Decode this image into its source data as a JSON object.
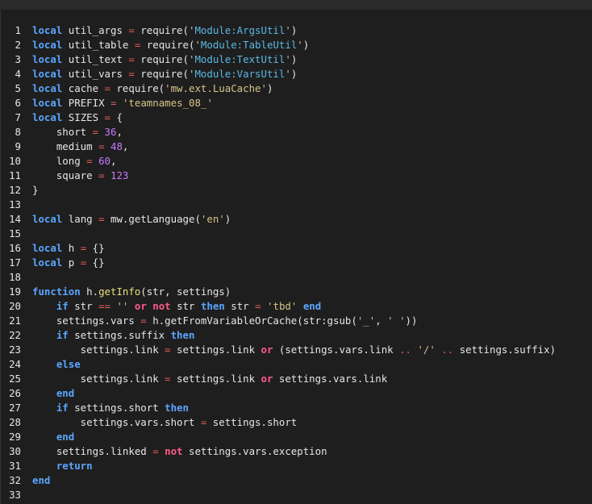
{
  "editor": {
    "lines": [
      {
        "n": "1",
        "tokens": [
          [
            "kw",
            "local"
          ],
          [
            "plain",
            " util_args "
          ],
          [
            "op",
            "="
          ],
          [
            "plain",
            " require("
          ],
          [
            "str",
            "'"
          ],
          [
            "mod",
            "Module:ArgsUtil"
          ],
          [
            "str",
            "'"
          ],
          [
            "plain",
            ")"
          ]
        ]
      },
      {
        "n": "2",
        "tokens": [
          [
            "kw",
            "local"
          ],
          [
            "plain",
            " util_table "
          ],
          [
            "op",
            "="
          ],
          [
            "plain",
            " require("
          ],
          [
            "str",
            "'"
          ],
          [
            "mod",
            "Module:TableUtil"
          ],
          [
            "str",
            "'"
          ],
          [
            "plain",
            ")"
          ]
        ]
      },
      {
        "n": "3",
        "tokens": [
          [
            "kw",
            "local"
          ],
          [
            "plain",
            " util_text "
          ],
          [
            "op",
            "="
          ],
          [
            "plain",
            " require("
          ],
          [
            "str",
            "'"
          ],
          [
            "mod",
            "Module:TextUtil"
          ],
          [
            "str",
            "'"
          ],
          [
            "plain",
            ")"
          ]
        ]
      },
      {
        "n": "4",
        "tokens": [
          [
            "kw",
            "local"
          ],
          [
            "plain",
            " util_vars "
          ],
          [
            "op",
            "="
          ],
          [
            "plain",
            " require("
          ],
          [
            "str",
            "'"
          ],
          [
            "mod",
            "Module:VarsUtil"
          ],
          [
            "str",
            "'"
          ],
          [
            "plain",
            ")"
          ]
        ]
      },
      {
        "n": "5",
        "tokens": [
          [
            "kw",
            "local"
          ],
          [
            "plain",
            " cache "
          ],
          [
            "op",
            "="
          ],
          [
            "plain",
            " require("
          ],
          [
            "str",
            "'mw.ext.LuaCache'"
          ],
          [
            "plain",
            ")"
          ]
        ]
      },
      {
        "n": "6",
        "tokens": [
          [
            "kw",
            "local"
          ],
          [
            "plain",
            " PREFIX "
          ],
          [
            "op",
            "="
          ],
          [
            "plain",
            " "
          ],
          [
            "str",
            "'teamnames_08_'"
          ]
        ]
      },
      {
        "n": "7",
        "tokens": [
          [
            "kw",
            "local"
          ],
          [
            "plain",
            " SIZES "
          ],
          [
            "op",
            "="
          ],
          [
            "plain",
            " {"
          ]
        ]
      },
      {
        "n": "8",
        "tokens": [
          [
            "plain",
            "    short "
          ],
          [
            "op",
            "="
          ],
          [
            "plain",
            " "
          ],
          [
            "num",
            "36"
          ],
          [
            "plain",
            ","
          ]
        ]
      },
      {
        "n": "9",
        "tokens": [
          [
            "plain",
            "    medium "
          ],
          [
            "op",
            "="
          ],
          [
            "plain",
            " "
          ],
          [
            "num",
            "48"
          ],
          [
            "plain",
            ","
          ]
        ]
      },
      {
        "n": "10",
        "tokens": [
          [
            "plain",
            "    long "
          ],
          [
            "op",
            "="
          ],
          [
            "plain",
            " "
          ],
          [
            "num",
            "60"
          ],
          [
            "plain",
            ","
          ]
        ]
      },
      {
        "n": "11",
        "tokens": [
          [
            "plain",
            "    square "
          ],
          [
            "op",
            "="
          ],
          [
            "plain",
            " "
          ],
          [
            "num",
            "123"
          ]
        ]
      },
      {
        "n": "12",
        "tokens": [
          [
            "plain",
            "}"
          ]
        ]
      },
      {
        "n": "13",
        "tokens": []
      },
      {
        "n": "14",
        "tokens": [
          [
            "kw",
            "local"
          ],
          [
            "plain",
            " lang "
          ],
          [
            "op",
            "="
          ],
          [
            "plain",
            " mw.getLanguage("
          ],
          [
            "str",
            "'en'"
          ],
          [
            "plain",
            ")"
          ]
        ]
      },
      {
        "n": "15",
        "tokens": []
      },
      {
        "n": "16",
        "tokens": [
          [
            "kw",
            "local"
          ],
          [
            "plain",
            " h "
          ],
          [
            "op",
            "="
          ],
          [
            "plain",
            " {}"
          ]
        ]
      },
      {
        "n": "17",
        "tokens": [
          [
            "kw",
            "local"
          ],
          [
            "plain",
            " p "
          ],
          [
            "op",
            "="
          ],
          [
            "plain",
            " {}"
          ]
        ]
      },
      {
        "n": "18",
        "tokens": []
      },
      {
        "n": "19",
        "tokens": [
          [
            "kw",
            "function"
          ],
          [
            "plain",
            " h."
          ],
          [
            "fn",
            "getInfo"
          ],
          [
            "plain",
            "(str, settings)"
          ]
        ]
      },
      {
        "n": "20",
        "tokens": [
          [
            "plain",
            "    "
          ],
          [
            "kw",
            "if"
          ],
          [
            "plain",
            " str "
          ],
          [
            "op",
            "=="
          ],
          [
            "plain",
            " "
          ],
          [
            "str",
            "''"
          ],
          [
            "plain",
            " "
          ],
          [
            "kw2",
            "or"
          ],
          [
            "plain",
            " "
          ],
          [
            "kw2",
            "not"
          ],
          [
            "plain",
            " str "
          ],
          [
            "kw",
            "then"
          ],
          [
            "plain",
            " str "
          ],
          [
            "op",
            "="
          ],
          [
            "plain",
            " "
          ],
          [
            "str",
            "'tbd'"
          ],
          [
            "plain",
            " "
          ],
          [
            "kw",
            "end"
          ]
        ]
      },
      {
        "n": "21",
        "tokens": [
          [
            "plain",
            "    settings.vars "
          ],
          [
            "op",
            "="
          ],
          [
            "plain",
            " h.getFromVariableOrCache(str:gsub("
          ],
          [
            "str",
            "'_'"
          ],
          [
            "plain",
            ", "
          ],
          [
            "str",
            "' '"
          ],
          [
            "plain",
            "))"
          ]
        ]
      },
      {
        "n": "22",
        "tokens": [
          [
            "plain",
            "    "
          ],
          [
            "kw",
            "if"
          ],
          [
            "plain",
            " settings.suffix "
          ],
          [
            "kw",
            "then"
          ]
        ]
      },
      {
        "n": "23",
        "tokens": [
          [
            "plain",
            "        settings.link "
          ],
          [
            "op",
            "="
          ],
          [
            "plain",
            " settings.link "
          ],
          [
            "kw2",
            "or"
          ],
          [
            "plain",
            " (settings.vars.link "
          ],
          [
            "op",
            ".."
          ],
          [
            "plain",
            " "
          ],
          [
            "str",
            "'/'"
          ],
          [
            "plain",
            " "
          ],
          [
            "op",
            ".."
          ],
          [
            "plain",
            " settings.suffix)"
          ]
        ]
      },
      {
        "n": "24",
        "tokens": [
          [
            "plain",
            "    "
          ],
          [
            "kw",
            "else"
          ]
        ]
      },
      {
        "n": "25",
        "tokens": [
          [
            "plain",
            "        settings.link "
          ],
          [
            "op",
            "="
          ],
          [
            "plain",
            " settings.link "
          ],
          [
            "kw2",
            "or"
          ],
          [
            "plain",
            " settings.vars.link"
          ]
        ]
      },
      {
        "n": "26",
        "tokens": [
          [
            "plain",
            "    "
          ],
          [
            "kw",
            "end"
          ]
        ]
      },
      {
        "n": "27",
        "tokens": [
          [
            "plain",
            "    "
          ],
          [
            "kw",
            "if"
          ],
          [
            "plain",
            " settings.short "
          ],
          [
            "kw",
            "then"
          ]
        ]
      },
      {
        "n": "28",
        "tokens": [
          [
            "plain",
            "        settings.vars.short "
          ],
          [
            "op",
            "="
          ],
          [
            "plain",
            " settings.short"
          ]
        ]
      },
      {
        "n": "29",
        "tokens": [
          [
            "plain",
            "    "
          ],
          [
            "kw",
            "end"
          ]
        ]
      },
      {
        "n": "30",
        "tokens": [
          [
            "plain",
            "    settings.linked "
          ],
          [
            "op",
            "="
          ],
          [
            "plain",
            " "
          ],
          [
            "kw2",
            "not"
          ],
          [
            "plain",
            " settings.vars.exception"
          ]
        ]
      },
      {
        "n": "31",
        "tokens": [
          [
            "plain",
            "    "
          ],
          [
            "kw",
            "return"
          ]
        ]
      },
      {
        "n": "32",
        "tokens": [
          [
            "kw",
            "end"
          ]
        ]
      },
      {
        "n": "33",
        "tokens": []
      }
    ]
  }
}
